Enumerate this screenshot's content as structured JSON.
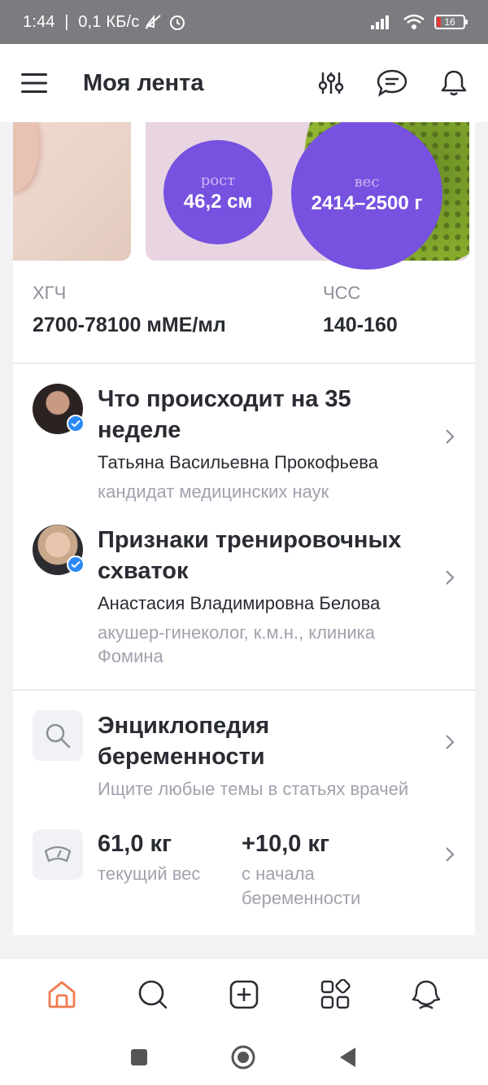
{
  "status_bar": {
    "time": "1:44",
    "net_speed": "0,1 КБ/с",
    "battery": "16"
  },
  "header": {
    "title": "Моя лента"
  },
  "hero": {
    "height_label": "рост",
    "height_value": "46,2 см",
    "weight_label": "вес",
    "weight_value": "2414–2500 г"
  },
  "stats": {
    "hcg_label": "ХГЧ",
    "hcg_value": "2700-78100 мМЕ/мл",
    "hr_label": "ЧСС",
    "hr_value": "140-160"
  },
  "articles": [
    {
      "title": "Что происходит на 35 неделе",
      "author": "Татьяна Васильевна Прокофьева",
      "role": "кандидат медицинских наук"
    },
    {
      "title": "Признаки тренировочных схваток",
      "author": "Анастасия Владимировна Белова",
      "role": "акушер-гинеколог, к.м.н., клиника Фомина"
    }
  ],
  "encyclopedia": {
    "title": "Энциклопедия беременности",
    "subtitle": "Ищите любые темы в статьях врачей"
  },
  "weight_tracker": {
    "current_value": "61,0 кг",
    "current_label": "текущий вес",
    "gain_value": "+10,0 кг",
    "gain_label": "с начала беременности"
  },
  "colors": {
    "accent": "#7751df",
    "home_active": "#f07a4e",
    "verified": "#2b8af6"
  }
}
